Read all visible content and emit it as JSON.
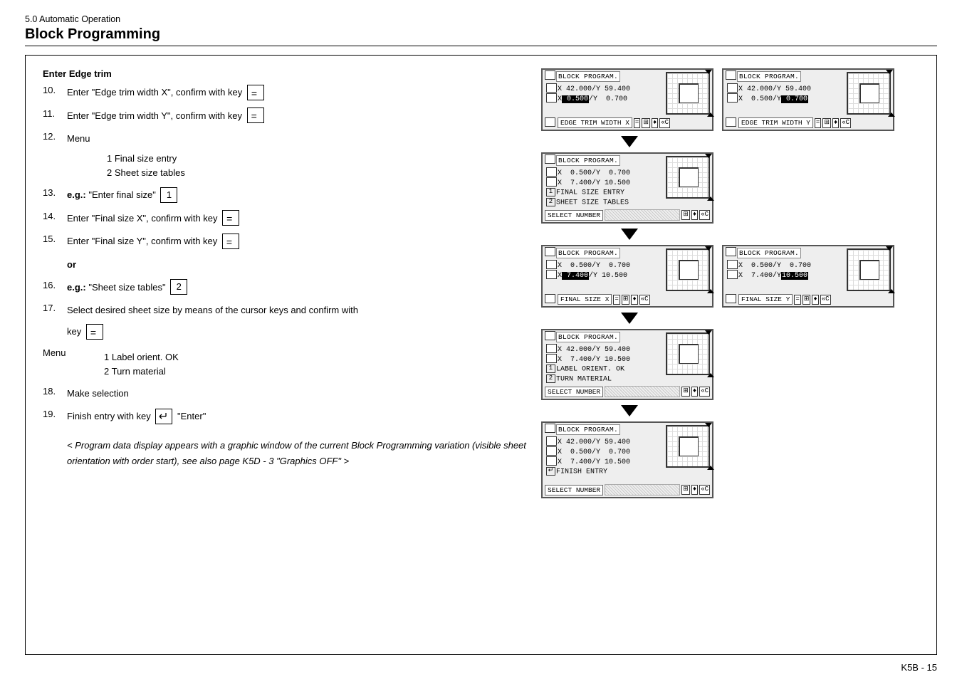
{
  "header": "5.0 Automatic Operation",
  "title": "Block Programming",
  "section_hdr": "Enter Edge trim",
  "steps": {
    "s10": {
      "n": "10.",
      "t": "Enter \"Edge trim width X\", confirm with key"
    },
    "s11": {
      "n": "11.",
      "t": "Enter \"Edge trim width Y\", confirm with key"
    },
    "s12": {
      "n": "12.",
      "t": "Menu",
      "menu1": "1 Final size entry",
      "menu2": "2 Sheet size tables"
    },
    "s13": {
      "n": "13.",
      "pre": "e.g.:",
      "t": " \"Enter final size\"",
      "key": "1"
    },
    "s14": {
      "n": "14.",
      "t": "Enter \"Final size X\", confirm with key"
    },
    "s15": {
      "n": "15.",
      "t": "Enter \"Final size Y\", confirm with key"
    },
    "or": "or",
    "s16": {
      "n": "16.",
      "pre": "e.g.:",
      "t": " \"Sheet size tables\"",
      "key": "2"
    },
    "s17": {
      "n": "17.",
      "t1": "Select desired sheet size by means of the cursor keys and confirm with",
      "t2": "key"
    },
    "menu_b": {
      "t": "Menu",
      "m1": "1 Label orient. OK",
      "m2": "2 Turn material"
    },
    "s18": {
      "n": "18.",
      "t": "Make selection"
    },
    "s19": {
      "n": "19.",
      "t1": "Finish entry with key",
      "t2": " \"Enter\""
    },
    "note": "< Program data display appears with a graphic window of the current Block Programming variation (visible sheet orientation with order start), see also page K5D - 3 \"Graphics OFF\" >"
  },
  "lcd": {
    "title": "BLOCK PROGRAM.",
    "r1a": "X 42.000/Y 59.400",
    "r1b": "X  0.500/Y  0.700",
    "edgeX": "EDGE TRIM WIDTH X",
    "edgeY": "EDGE TRIM WIDTH Y",
    "r2a": "X  0.500/Y  0.700",
    "r2b": "X  7.400/Y 10.500",
    "m1": "FINAL SIZE ENTRY",
    "m2": "SHEET SIZE TABLES",
    "sel": "SELECT NUMBER",
    "r3a": "X  0.500/Y  0.700",
    "r3b": "X  7.400/Y 10.500",
    "finX": "FINAL SIZE X",
    "finY": "FINAL SIZE Y",
    "r4a": "X 42.000/Y 59.400",
    "r4b": "X  7.400/Y 10.500",
    "lo": "LABEL ORIENT. OK",
    "tm": "TURN MATERIAL",
    "r5a": "X 42.000/Y 59.400",
    "r5b": "X  0.500/Y  0.700",
    "r5c": "X  7.400/Y 10.500",
    "fe": "FINISH ENTRY",
    "inv0500": " 0.500",
    "inv0700": " 0.700",
    "inv7400": " 7.400",
    "inv10500": "10.500",
    "eq": "=",
    "grid": "⊞",
    "updn": "♦",
    "cc": "«C"
  },
  "foot": "K5B - 15"
}
